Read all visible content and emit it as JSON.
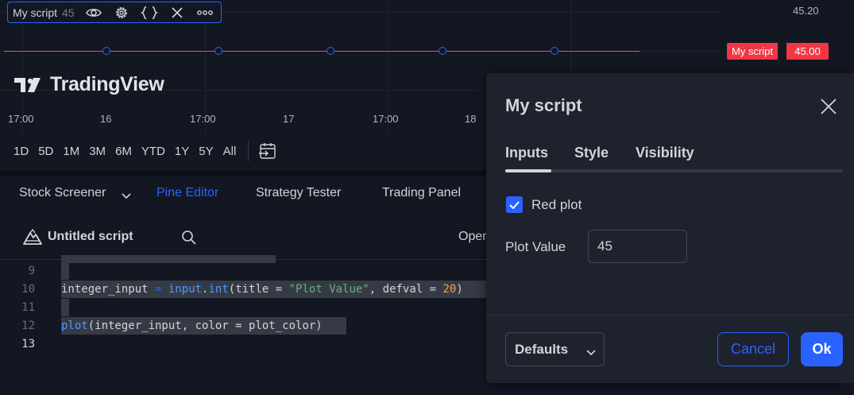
{
  "legend": {
    "name": "My script",
    "value": "45",
    "icons": [
      "eye-icon",
      "gear-icon",
      "braces-icon",
      "close-icon",
      "more-icon"
    ]
  },
  "price_axis": {
    "top_label": "45.20",
    "tag_name": "My script",
    "tag_value": "45.00",
    "tag_color": "#f23645"
  },
  "plot": {
    "line_color": "#e05a5a",
    "marker_color": "#2962ff"
  },
  "brand": {
    "name": "TradingView"
  },
  "time_axis": {
    "ticks": [
      "17:00",
      "16",
      "17:00",
      "17",
      "17:00",
      "18"
    ]
  },
  "range_buttons": [
    "1D",
    "5D",
    "1M",
    "3M",
    "6M",
    "YTD",
    "1Y",
    "5Y",
    "All"
  ],
  "bottom_tabs": {
    "screener": "Stock Screener",
    "pine": "Pine Editor",
    "strategy": "Strategy Tester",
    "trading": "Trading Panel"
  },
  "editor": {
    "script_title": "Untitled script",
    "open_label": "Oper"
  },
  "code_lines": [
    {
      "n": "9"
    },
    {
      "n": "10",
      "parts": [
        "integer_input",
        " = ",
        "input",
        ".",
        "int",
        "(title = ",
        "\"Plot Value\"",
        ", defval = ",
        "20",
        ")"
      ]
    },
    {
      "n": "11"
    },
    {
      "n": "12",
      "parts": [
        "plot",
        "(integer_input, color = plot_color)"
      ]
    },
    {
      "n": "13"
    }
  ],
  "dialog": {
    "title": "My script",
    "tabs": [
      "Inputs",
      "Style",
      "Visibility"
    ],
    "active_tab": "Inputs",
    "checkbox_label": "Red plot",
    "checkbox_checked": true,
    "field_label": "Plot Value",
    "field_value": "45",
    "defaults_label": "Defaults",
    "cancel_label": "Cancel",
    "ok_label": "Ok",
    "accent_color": "#2962ff"
  }
}
